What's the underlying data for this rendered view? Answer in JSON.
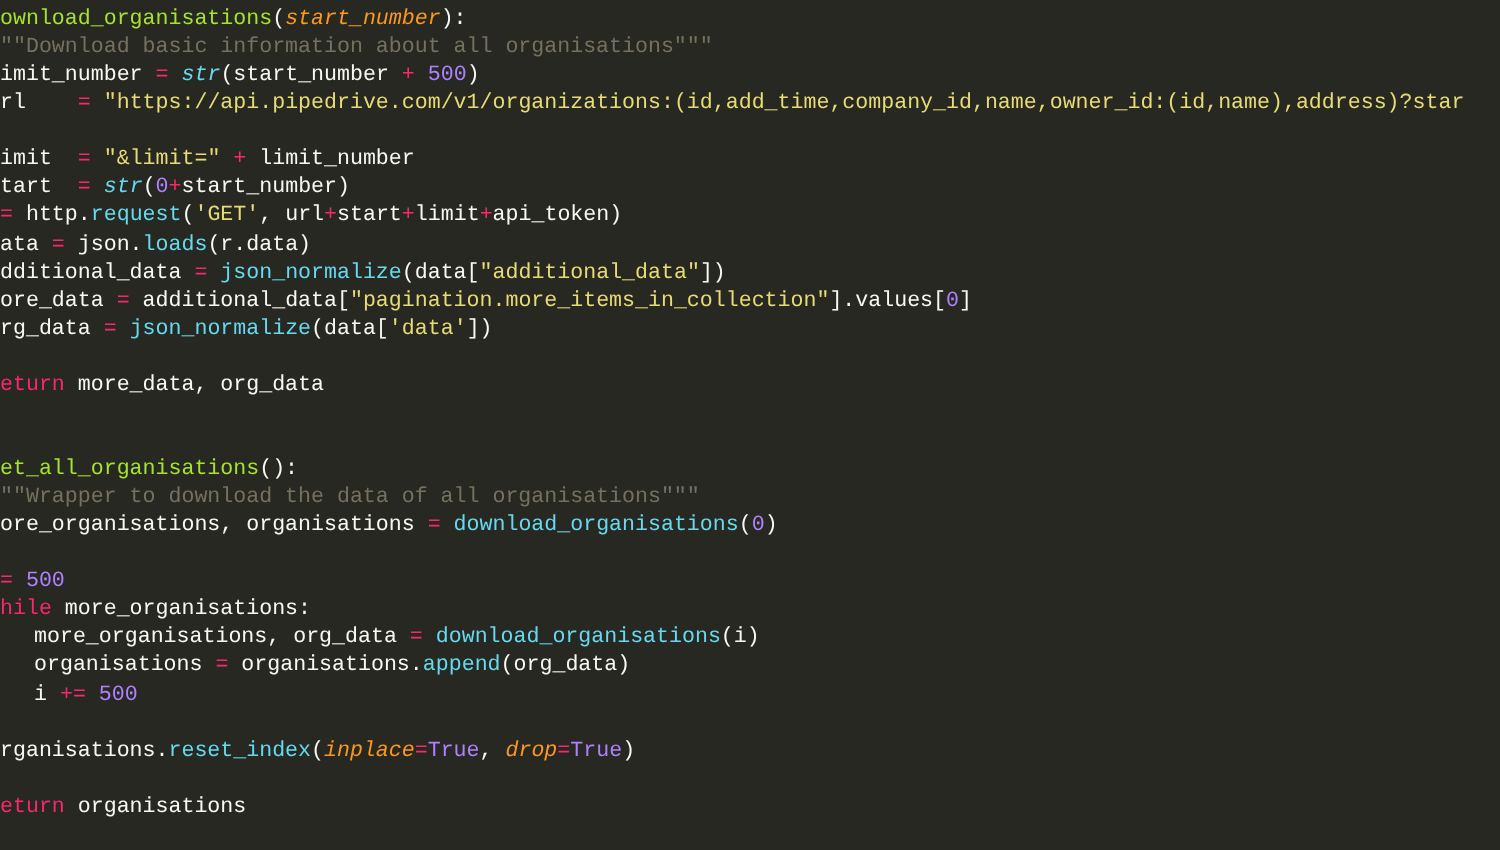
{
  "editor": {
    "lines": [
      {
        "kind": "code",
        "tokens": [
          {
            "text": "ownload_organisations",
            "kind": "function"
          },
          {
            "text": "(",
            "kind": "plain"
          },
          {
            "text": "start_number",
            "kind": "param"
          },
          {
            "text": "):",
            "kind": "plain"
          }
        ]
      },
      {
        "kind": "code",
        "tokens": [
          {
            "text": "\"\"Download basic information about all organisations\"\"\"",
            "kind": "comment"
          }
        ]
      },
      {
        "kind": "code",
        "tokens": [
          {
            "text": "imit_number ",
            "kind": "plain"
          },
          {
            "text": "= ",
            "kind": "operator"
          },
          {
            "text": "str",
            "kind": "builtin"
          },
          {
            "text": "(start_number ",
            "kind": "plain"
          },
          {
            "text": "+ ",
            "kind": "operator"
          },
          {
            "text": "500",
            "kind": "number"
          },
          {
            "text": ")",
            "kind": "plain"
          }
        ]
      },
      {
        "kind": "code",
        "tokens": [
          {
            "text": "rl    ",
            "kind": "plain"
          },
          {
            "text": "= ",
            "kind": "operator"
          },
          {
            "text": "\"https://api.pipedrive.com/v1/organizations:(id,add_time,company_id,name,owner_id:(id,name),address)?star",
            "kind": "string"
          }
        ]
      },
      {
        "kind": "blank"
      },
      {
        "kind": "code",
        "tokens": [
          {
            "text": "imit  ",
            "kind": "plain"
          },
          {
            "text": "= ",
            "kind": "operator"
          },
          {
            "text": "\"&limit=\" ",
            "kind": "string"
          },
          {
            "text": "+",
            "kind": "operator"
          },
          {
            "text": " limit_number",
            "kind": "plain"
          }
        ]
      },
      {
        "kind": "code",
        "tokens": [
          {
            "text": "tart  ",
            "kind": "plain"
          },
          {
            "text": "= ",
            "kind": "operator"
          },
          {
            "text": "str",
            "kind": "builtin"
          },
          {
            "text": "(",
            "kind": "plain"
          },
          {
            "text": "0",
            "kind": "number"
          },
          {
            "text": "+",
            "kind": "operator"
          },
          {
            "text": "start_number)",
            "kind": "plain"
          }
        ]
      },
      {
        "kind": "code",
        "tokens": [
          {
            "text": "=",
            "kind": "operator"
          },
          {
            "text": " http.",
            "kind": "plain"
          },
          {
            "text": "request",
            "kind": "call"
          },
          {
            "text": "(",
            "kind": "plain"
          },
          {
            "text": "'GET'",
            "kind": "string"
          },
          {
            "text": ", url",
            "kind": "plain"
          },
          {
            "text": "+",
            "kind": "operator"
          },
          {
            "text": "start",
            "kind": "plain"
          },
          {
            "text": "+",
            "kind": "operator"
          },
          {
            "text": "limit",
            "kind": "plain"
          },
          {
            "text": "+",
            "kind": "operator"
          },
          {
            "text": "api_token)",
            "kind": "plain"
          }
        ]
      },
      {
        "kind": "code",
        "tokens": [
          {
            "text": "ata ",
            "kind": "plain"
          },
          {
            "text": "=",
            "kind": "operator"
          },
          {
            "text": " json.",
            "kind": "plain"
          },
          {
            "text": "loads",
            "kind": "call"
          },
          {
            "text": "(r.data)",
            "kind": "plain"
          }
        ]
      },
      {
        "kind": "code",
        "tokens": [
          {
            "text": "dditional_data ",
            "kind": "plain"
          },
          {
            "text": "= ",
            "kind": "operator"
          },
          {
            "text": "json_normalize",
            "kind": "call"
          },
          {
            "text": "(data[",
            "kind": "plain"
          },
          {
            "text": "\"additional_data\"",
            "kind": "string"
          },
          {
            "text": "])",
            "kind": "plain"
          }
        ]
      },
      {
        "kind": "code",
        "tokens": [
          {
            "text": "ore_data ",
            "kind": "plain"
          },
          {
            "text": "=",
            "kind": "operator"
          },
          {
            "text": " additional_data[",
            "kind": "plain"
          },
          {
            "text": "\"pagination.more_items_in_collection\"",
            "kind": "string"
          },
          {
            "text": "].values[",
            "kind": "plain"
          },
          {
            "text": "0",
            "kind": "number"
          },
          {
            "text": "]",
            "kind": "plain"
          }
        ]
      },
      {
        "kind": "code",
        "tokens": [
          {
            "text": "rg_data ",
            "kind": "plain"
          },
          {
            "text": "= ",
            "kind": "operator"
          },
          {
            "text": "json_normalize",
            "kind": "call"
          },
          {
            "text": "(data[",
            "kind": "plain"
          },
          {
            "text": "'data'",
            "kind": "string"
          },
          {
            "text": "])",
            "kind": "plain"
          }
        ]
      },
      {
        "kind": "blank"
      },
      {
        "kind": "code",
        "tokens": [
          {
            "text": "eturn",
            "kind": "keyword"
          },
          {
            "text": " more_data, org_data",
            "kind": "plain"
          }
        ]
      },
      {
        "kind": "blank"
      },
      {
        "kind": "blank"
      },
      {
        "kind": "code",
        "tokens": [
          {
            "text": "et_all_organisations",
            "kind": "function"
          },
          {
            "text": "():",
            "kind": "plain"
          }
        ]
      },
      {
        "kind": "code",
        "tokens": [
          {
            "text": "\"\"Wrapper to download the data of all organisations\"\"\"",
            "kind": "comment"
          }
        ]
      },
      {
        "kind": "code",
        "tokens": [
          {
            "text": "ore_organisations, organisations ",
            "kind": "plain"
          },
          {
            "text": "= ",
            "kind": "operator"
          },
          {
            "text": "download_organisations",
            "kind": "call"
          },
          {
            "text": "(",
            "kind": "plain"
          },
          {
            "text": "0",
            "kind": "number"
          },
          {
            "text": ")",
            "kind": "plain"
          }
        ]
      },
      {
        "kind": "blank"
      },
      {
        "kind": "code",
        "tokens": [
          {
            "text": "= ",
            "kind": "operator"
          },
          {
            "text": "500",
            "kind": "number"
          }
        ]
      },
      {
        "kind": "code",
        "tokens": [
          {
            "text": "hile",
            "kind": "keyword"
          },
          {
            "text": " more_organisations:",
            "kind": "plain"
          }
        ]
      },
      {
        "kind": "code",
        "indented": true,
        "tokens": [
          {
            "text": "more_organisations, org_data ",
            "kind": "plain"
          },
          {
            "text": "= ",
            "kind": "operator"
          },
          {
            "text": "download_organisations",
            "kind": "call"
          },
          {
            "text": "(i)",
            "kind": "plain"
          }
        ]
      },
      {
        "kind": "code",
        "indented": true,
        "tokens": [
          {
            "text": "organisations ",
            "kind": "plain"
          },
          {
            "text": "=",
            "kind": "operator"
          },
          {
            "text": " organisations.",
            "kind": "plain"
          },
          {
            "text": "append",
            "kind": "call"
          },
          {
            "text": "(org_data)",
            "kind": "plain"
          }
        ]
      },
      {
        "kind": "code",
        "indented": true,
        "tokens": [
          {
            "text": "i ",
            "kind": "plain"
          },
          {
            "text": "+= ",
            "kind": "operator"
          },
          {
            "text": "500",
            "kind": "number"
          }
        ]
      },
      {
        "kind": "blank"
      },
      {
        "kind": "code",
        "tokens": [
          {
            "text": "rganisations.",
            "kind": "plain"
          },
          {
            "text": "reset_index",
            "kind": "call"
          },
          {
            "text": "(",
            "kind": "plain"
          },
          {
            "text": "inplace",
            "kind": "param"
          },
          {
            "text": "=",
            "kind": "operator"
          },
          {
            "text": "True",
            "kind": "number"
          },
          {
            "text": ", ",
            "kind": "plain"
          },
          {
            "text": "drop",
            "kind": "param"
          },
          {
            "text": "=",
            "kind": "operator"
          },
          {
            "text": "True",
            "kind": "number"
          },
          {
            "text": ")",
            "kind": "plain"
          }
        ]
      },
      {
        "kind": "blank"
      },
      {
        "kind": "code",
        "tokens": [
          {
            "text": "eturn",
            "kind": "keyword"
          },
          {
            "text": " organisations",
            "kind": "plain"
          }
        ]
      }
    ]
  }
}
